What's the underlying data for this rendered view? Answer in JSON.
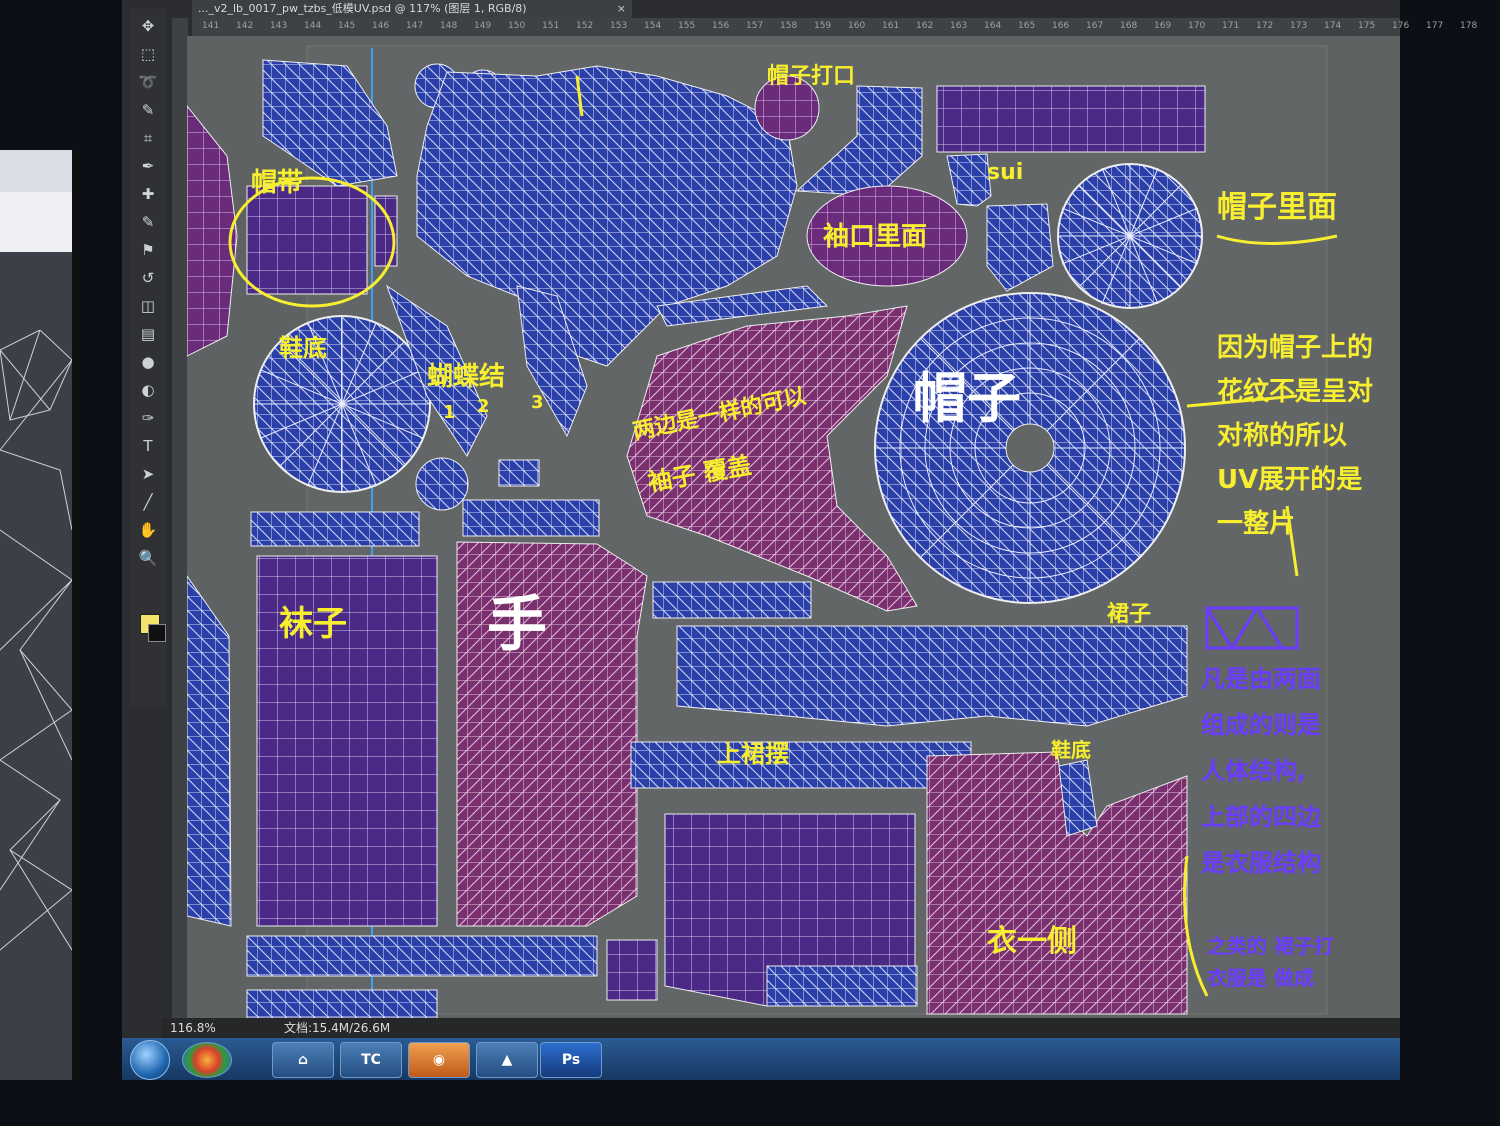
{
  "window": {
    "doc_tab_title": "..._v2_lb_0017_pw_tzbs_低模UV.psd @ 117% (图层 1, RGB/8)",
    "close_glyph": "×"
  },
  "ruler": {
    "ticks": [
      "141",
      "142",
      "143",
      "144",
      "145",
      "146",
      "147",
      "148",
      "149",
      "150",
      "151",
      "152",
      "153",
      "154",
      "155",
      "156",
      "157",
      "158",
      "159",
      "160",
      "161",
      "162",
      "163",
      "164",
      "165",
      "166",
      "167",
      "168",
      "169",
      "170",
      "171",
      "172",
      "173",
      "174",
      "175",
      "176",
      "177",
      "178"
    ]
  },
  "tools": [
    "move-icon",
    "marquee-icon",
    "lasso-icon",
    "quick-select-icon",
    "crop-icon",
    "eyedropper-icon",
    "healing-icon",
    "brush-icon",
    "stamp-icon",
    "history-brush-icon",
    "eraser-icon",
    "gradient-icon",
    "blur-icon",
    "dodge-icon",
    "pen-icon",
    "type-icon",
    "path-select-icon",
    "line-icon",
    "hand-icon",
    "zoom-icon"
  ],
  "tool_glyphs": [
    "✥",
    "⬚",
    "➰",
    "✎",
    "⌗",
    "✒",
    "✚",
    "✎",
    "⚑",
    "↺",
    "◫",
    "▤",
    "●",
    "◐",
    "✑",
    "T",
    "➤",
    "╱",
    "✋",
    "🔍"
  ],
  "colors": {
    "foreground": "#f3e36a",
    "background": "#111111",
    "uv_blue": "#2b3fa8",
    "uv_purple": "#6a2c7a",
    "annotation_yellow": "#f6ee2f",
    "annotation_purple": "#6a3cff"
  },
  "status": {
    "zoom": "116.8%",
    "doc_size": "文档:15.4M/26.6M"
  },
  "taskbar": {
    "items": [
      "start-orb",
      "pinwheel",
      "app-3dsmax",
      "app-tc",
      "app-ie",
      "app-maya",
      "app-ps"
    ],
    "ps_label": "Ps"
  },
  "annotations": {
    "hat_strings": "帽带",
    "hat_strap": "帽子打口",
    "sui": "sui",
    "cuff_inner": "袖口里面",
    "hat_surface": "帽子里面",
    "sock_bottom": "鞋底",
    "butterfly": "蝴蝶结",
    "overlap_note_1": "两边是一样的可以",
    "overlap_note_2": "袖子 覆盖",
    "hat": "帽子",
    "hat_explain": [
      "因为帽子上的",
      "花纹不是呈对",
      "对称的所以",
      "UV展开的是",
      "一整片"
    ],
    "socks": "袜子",
    "hand": "手",
    "skirt": "裙子",
    "upper_skirt_hem": "上裙摆",
    "shoe_sole": "鞋底",
    "clothes_side": "衣一侧",
    "purple_note": [
      "凡是由两面",
      "组成的则是",
      "人体结构,",
      "上部的四边",
      "是衣服结构"
    ],
    "bottom_note": [
      "之类的 裙子打",
      "衣服是 做成"
    ],
    "circled_1": "1",
    "circled_2": "2",
    "circled_3": "3"
  }
}
